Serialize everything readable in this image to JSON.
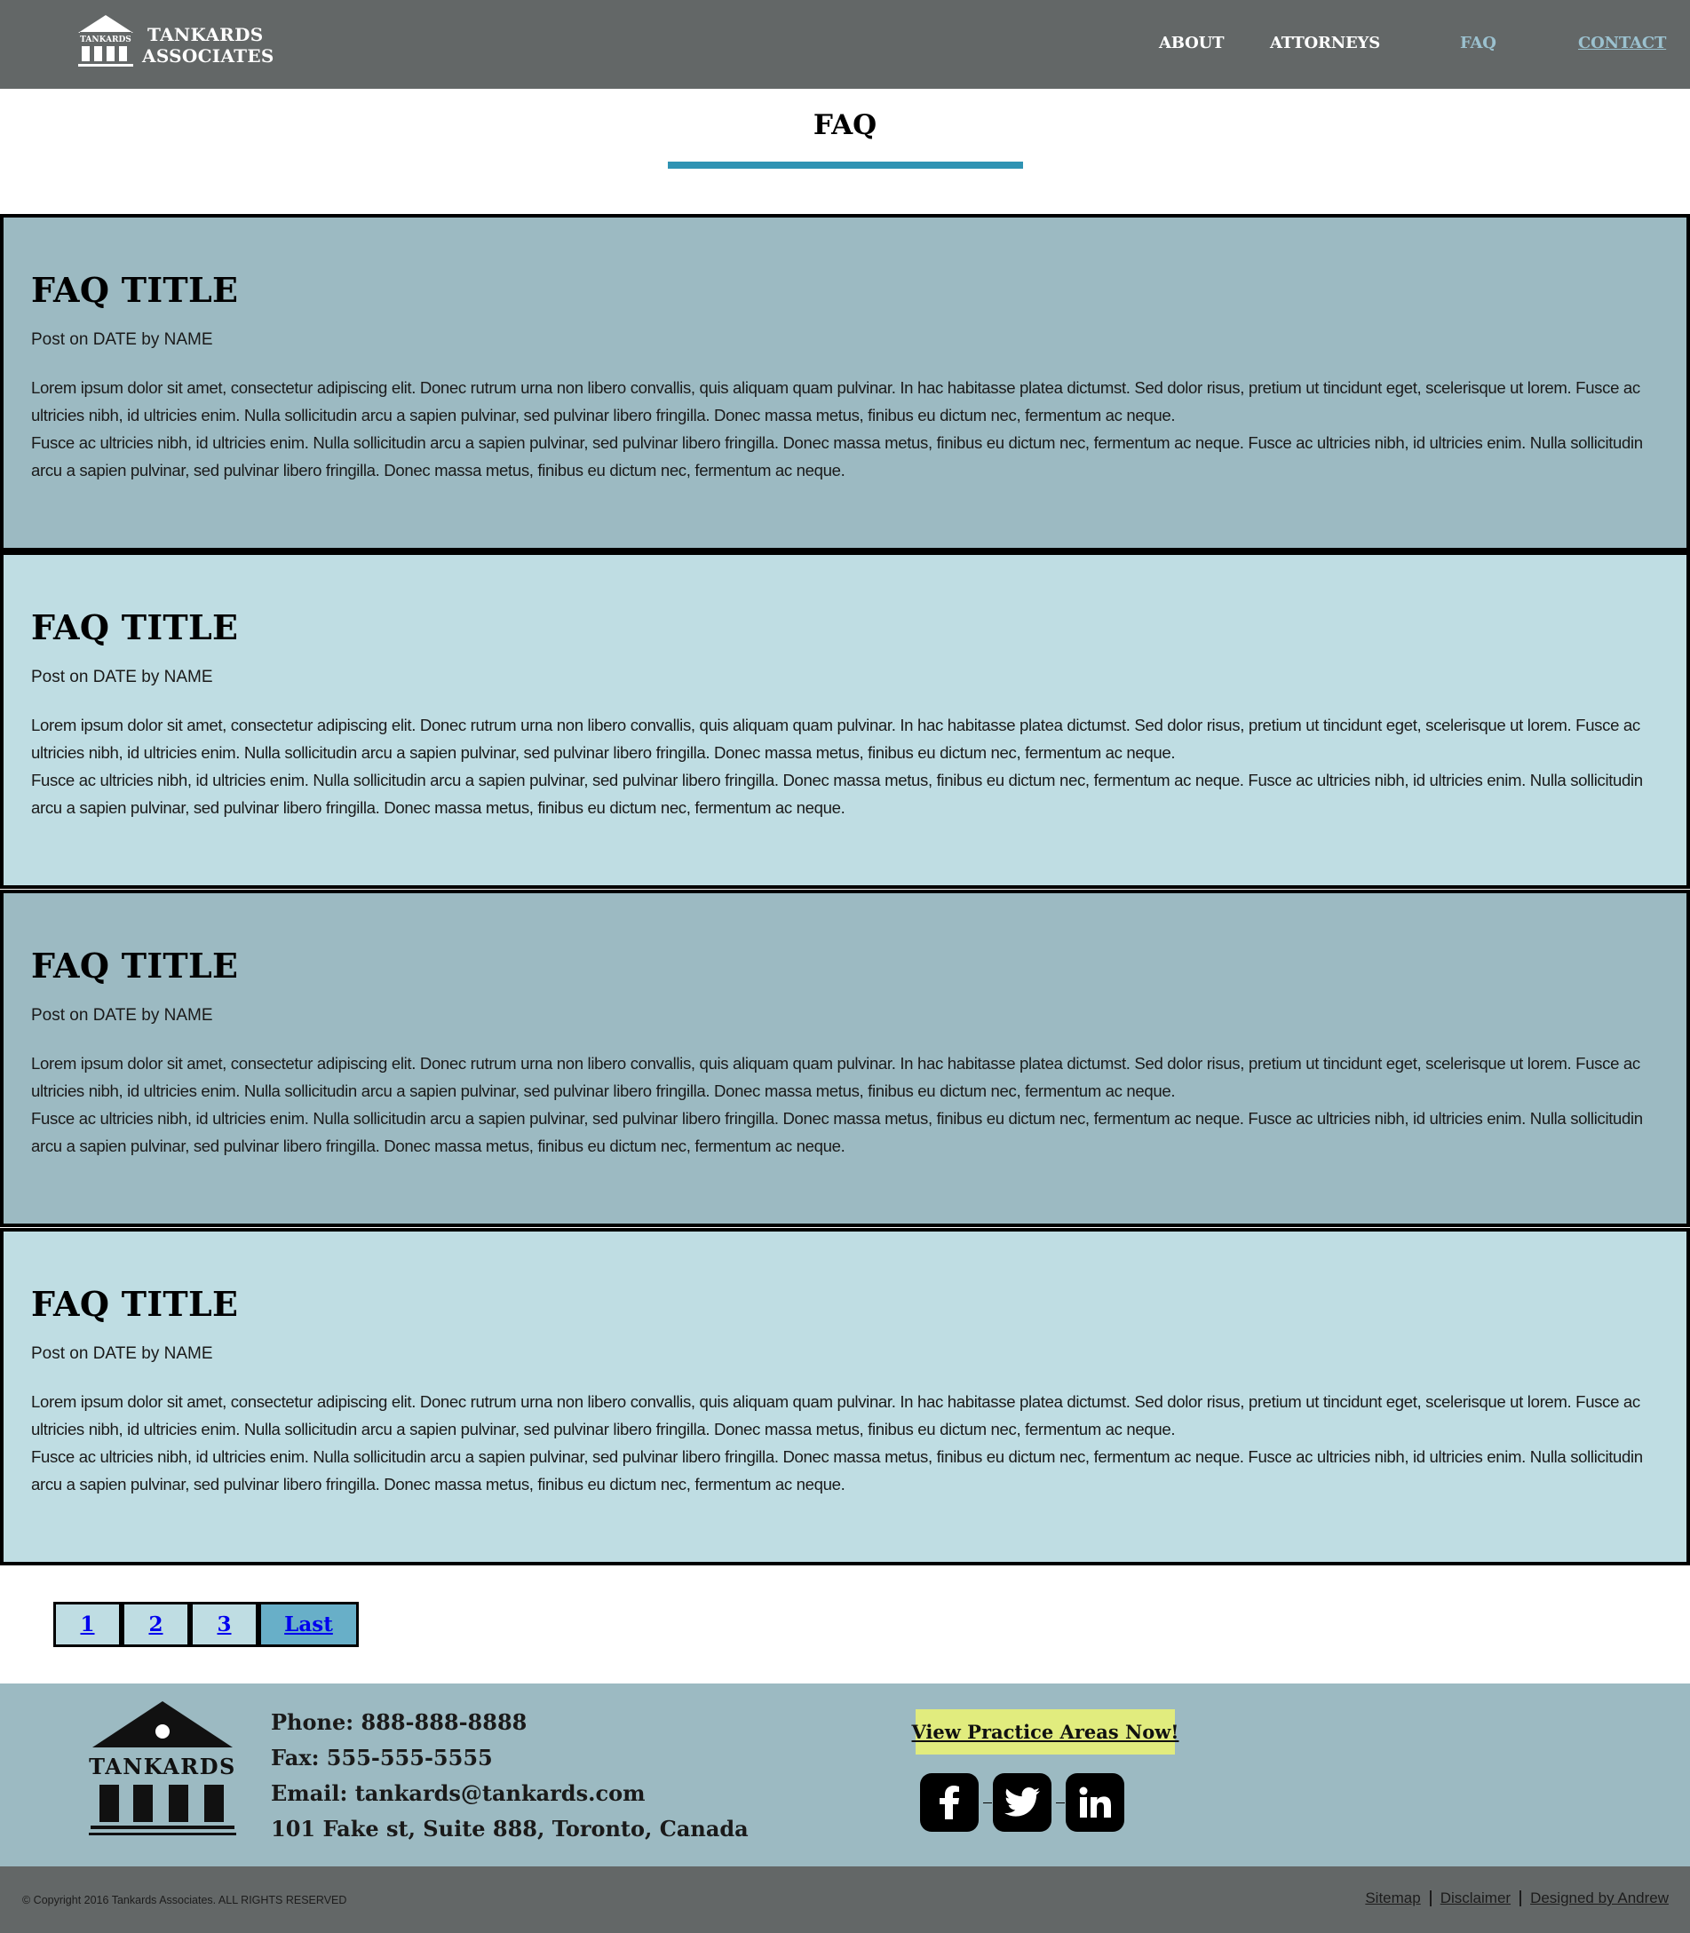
{
  "header": {
    "logo": {
      "line1": "TANKARDS",
      "line2": "ASSOCIATES",
      "emblem_text": "TANKARDS"
    },
    "nav": [
      {
        "label": "ABOUT"
      },
      {
        "label": "ATTORNEYS"
      },
      {
        "label": "FAQ",
        "active": true
      },
      {
        "label": "CONTACT"
      }
    ]
  },
  "page": {
    "title": "FAQ"
  },
  "faqs": [
    {
      "title": "FAQ TITLE",
      "meta": "Post on DATE by NAME",
      "para1": "Lorem ipsum dolor sit amet, consectetur adipiscing elit. Donec rutrum urna non libero convallis, quis aliquam quam pulvinar. In hac habitasse platea dictumst. Sed dolor risus, pretium ut tincidunt eget, scelerisque ut lorem. Fusce ac ultricies nibh, id ultricies enim. Nulla sollicitudin arcu a sapien pulvinar, sed pulvinar libero fringilla. Donec massa metus, finibus eu dictum nec, fermentum ac neque.",
      "para2": "Fusce ac ultricies nibh, id ultricies enim. Nulla sollicitudin arcu a sapien pulvinar, sed pulvinar libero fringilla. Donec massa metus, finibus eu dictum nec, fermentum ac neque. Fusce ac ultricies nibh, id ultricies enim. Nulla sollicitudin arcu a sapien pulvinar, sed pulvinar libero fringilla. Donec massa metus, finibus eu dictum nec, fermentum ac neque."
    },
    {
      "title": "FAQ TITLE",
      "meta": "Post on DATE by NAME",
      "para1": "Lorem ipsum dolor sit amet, consectetur adipiscing elit. Donec rutrum urna non libero convallis, quis aliquam quam pulvinar. In hac habitasse platea dictumst. Sed dolor risus, pretium ut tincidunt eget, scelerisque ut lorem. Fusce ac ultricies nibh, id ultricies enim. Nulla sollicitudin arcu a sapien pulvinar, sed pulvinar libero fringilla. Donec massa metus, finibus eu dictum nec, fermentum ac neque.",
      "para2": "Fusce ac ultricies nibh, id ultricies enim. Nulla sollicitudin arcu a sapien pulvinar, sed pulvinar libero fringilla. Donec massa metus, finibus eu dictum nec, fermentum ac neque. Fusce ac ultricies nibh, id ultricies enim. Nulla sollicitudin arcu a sapien pulvinar, sed pulvinar libero fringilla. Donec massa metus, finibus eu dictum nec, fermentum ac neque."
    },
    {
      "title": "FAQ TITLE",
      "meta": "Post on DATE by NAME",
      "para1": "Lorem ipsum dolor sit amet, consectetur adipiscing elit. Donec rutrum urna non libero convallis, quis aliquam quam pulvinar. In hac habitasse platea dictumst. Sed dolor risus, pretium ut tincidunt eget, scelerisque ut lorem. Fusce ac ultricies nibh, id ultricies enim. Nulla sollicitudin arcu a sapien pulvinar, sed pulvinar libero fringilla. Donec massa metus, finibus eu dictum nec, fermentum ac neque.",
      "para2": "Fusce ac ultricies nibh, id ultricies enim. Nulla sollicitudin arcu a sapien pulvinar, sed pulvinar libero fringilla. Donec massa metus, finibus eu dictum nec, fermentum ac neque. Fusce ac ultricies nibh, id ultricies enim. Nulla sollicitudin arcu a sapien pulvinar, sed pulvinar libero fringilla. Donec massa metus, finibus eu dictum nec, fermentum ac neque."
    },
    {
      "title": "FAQ TITLE",
      "meta": "Post on DATE by NAME",
      "para1": "Lorem ipsum dolor sit amet, consectetur adipiscing elit. Donec rutrum urna non libero convallis, quis aliquam quam pulvinar. In hac habitasse platea dictumst. Sed dolor risus, pretium ut tincidunt eget, scelerisque ut lorem. Fusce ac ultricies nibh, id ultricies enim. Nulla sollicitudin arcu a sapien pulvinar, sed pulvinar libero fringilla. Donec massa metus, finibus eu dictum nec, fermentum ac neque.",
      "para2": "Fusce ac ultricies nibh, id ultricies enim. Nulla sollicitudin arcu a sapien pulvinar, sed pulvinar libero fringilla. Donec massa metus, finibus eu dictum nec, fermentum ac neque. Fusce ac ultricies nibh, id ultricies enim. Nulla sollicitudin arcu a sapien pulvinar, sed pulvinar libero fringilla. Donec massa metus, finibus eu dictum nec, fermentum ac neque."
    }
  ],
  "pagination": {
    "pages": [
      "1",
      "2",
      "3"
    ],
    "last_label": "Last"
  },
  "footer": {
    "emblem_text": "TANKARDS",
    "phone": "Phone: 888-888-8888",
    "fax": "Fax: 555-555-5555",
    "email": "Email: tankards@tankards.com",
    "address": "101 Fake st, Suite 888, Toronto, Canada",
    "cta_label": "View Practice Areas Now!",
    "socials": [
      {
        "icon": "facebook-icon"
      },
      {
        "icon": "twitter-icon"
      },
      {
        "icon": "linkedin-icon"
      }
    ]
  },
  "bottom_bar": {
    "copyright": "© Copyright 2016 Tankards Associates. ALL RIGHTS RESERVED",
    "links": [
      "Sitemap",
      "Disclaimer",
      "Designed by Andrew"
    ]
  },
  "colors": {
    "header_bg": "#636767",
    "nav_active": "#9bc1cf",
    "title_underline": "#2f93b3",
    "panel_dark": "#9cbac2",
    "panel_light": "#bfdde3",
    "last_button": "#68afc8",
    "cta_bg": "#e1ec7e"
  }
}
